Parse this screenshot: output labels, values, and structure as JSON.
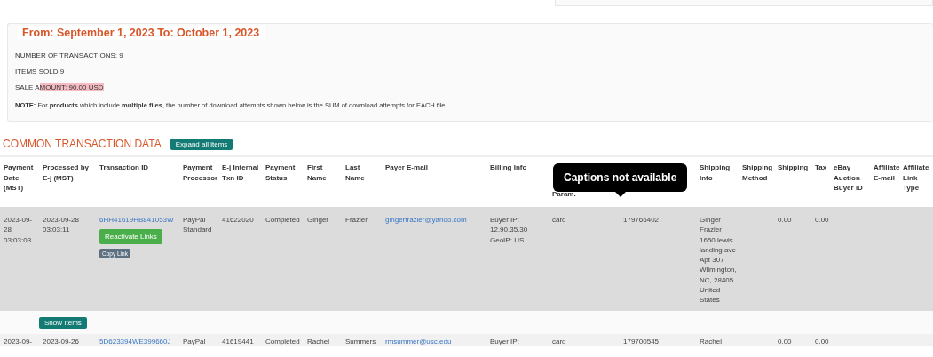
{
  "summary": {
    "title": "From: September 1, 2023 To: October 1, 2023",
    "lines": [
      {
        "kind": "plain",
        "text": "NUMBER OF TRANSACTIONS: 9"
      },
      {
        "kind": "plain",
        "text": "ITEMS SOLD:9"
      },
      {
        "kind": "highlight",
        "prefix": "SALE A",
        "highlighted": "MOUNT: 90.00 USD"
      }
    ],
    "note": "**NOTE:** For **products** which include **multiple files**, the number of download attempts shown below is the SUM of download attempts for EACH file."
  },
  "section": {
    "title": "COMMON TRANSACTION DATA",
    "button": "Expand all items"
  },
  "table": {
    "columns": [
      "Payment Date (MST)",
      "Processed by E-j (MST)",
      "Transaction ID",
      "Payment Processor",
      "E-j Internal Txn ID",
      "Payment Status",
      "First Name",
      "Last Name",
      "Payer E-mail",
      "Billing Info",
      {
        "kind": "covered",
        "text": "Param."
      },
      null,
      "Shipping Info",
      "Shipping Method",
      "Shipping",
      "Tax",
      "eBay Auction Buyer ID",
      "Affiliate E-mail",
      "Affiliate Link Type"
    ],
    "rows": [
      {
        "shaded": true,
        "cut": false,
        "show_items": "Show Items",
        "cells": [
          {
            "kind": "text",
            "text": "2023-09-28 03:03:03"
          },
          {
            "kind": "text",
            "text": "2023-09-28 03:03:11"
          },
          {
            "kind": "txn",
            "text": "6HH41619HB841053W",
            "primary": "Reactivate Links",
            "secondary": "Copy Link"
          },
          {
            "kind": "text",
            "text": "PayPal Standard"
          },
          {
            "kind": "text",
            "text": "41622020"
          },
          {
            "kind": "text",
            "text": "Completed"
          },
          {
            "kind": "text",
            "text": "Ginger"
          },
          {
            "kind": "text",
            "text": "Frazier"
          },
          {
            "kind": "link",
            "text": "gingerfrazier@yahoo.com"
          },
          {
            "kind": "text",
            "text": "Buyer IP: 12.90.35.30 GeoIP: US"
          },
          {
            "kind": "text",
            "text": "card"
          },
          {
            "kind": "text",
            "text": "179766402"
          },
          {
            "kind": "text",
            "text": "Ginger Frazier 1650 lewis landing ave Apt 307 Wilmington, NC, 28405 United States"
          },
          null,
          {
            "kind": "text",
            "text": "0.00"
          },
          {
            "kind": "text",
            "text": "0.00"
          },
          null,
          null,
          null
        ]
      },
      {
        "shaded": false,
        "cut": true,
        "cells": [
          {
            "kind": "text",
            "text": "2023-09-"
          },
          {
            "kind": "text",
            "text": "2023-09-26"
          },
          {
            "kind": "link",
            "text": "5D623394WE399660J"
          },
          {
            "kind": "text",
            "text": "PayPal"
          },
          {
            "kind": "text",
            "text": "41619441"
          },
          {
            "kind": "text",
            "text": "Completed"
          },
          {
            "kind": "text",
            "text": "Rachel"
          },
          {
            "kind": "text",
            "text": "Summers"
          },
          {
            "kind": "link",
            "text": "rmsummer@usc.edu"
          },
          {
            "kind": "text",
            "text": "Buyer IP:"
          },
          {
            "kind": "text",
            "text": "card"
          },
          {
            "kind": "text",
            "text": "179700545"
          },
          {
            "kind": "text",
            "text": "Rachel"
          },
          null,
          {
            "kind": "text",
            "text": "0.00"
          },
          {
            "kind": "text",
            "text": "0.00"
          },
          null,
          null,
          null
        ]
      }
    ]
  },
  "tooltip": {
    "text": "Captions not available"
  }
}
